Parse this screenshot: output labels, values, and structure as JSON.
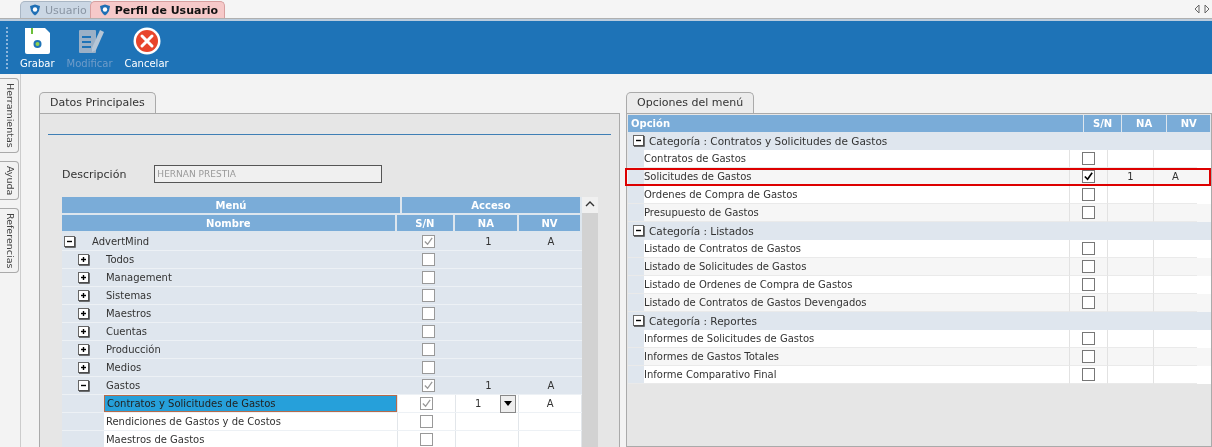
{
  "tabs": [
    {
      "label": "Usuario",
      "selected": false
    },
    {
      "label": "Perfil de Usuario",
      "selected": true
    }
  ],
  "toolbar": [
    {
      "label": "Grabar",
      "kind": "save",
      "disabled": false
    },
    {
      "label": "Modificar",
      "kind": "edit",
      "disabled": true
    },
    {
      "label": "Cancelar",
      "kind": "cancel",
      "disabled": false
    }
  ],
  "side_tabs": [
    "Herramientas",
    "Ayuda",
    "Referencias"
  ],
  "left_panel": {
    "tab": "Datos Principales",
    "description_label": "Descripción",
    "description_value": "HERNAN PRESTIA",
    "grid": {
      "group_headers": [
        "Menú",
        "Acceso"
      ],
      "columns": [
        "Nombre",
        "S/N",
        "NA",
        "NV"
      ],
      "rows": [
        {
          "name": "AdvertMind",
          "checked": true,
          "na": "1",
          "nv": "A",
          "expanded": true,
          "selected": false,
          "children": [
            {
              "name": "Todos",
              "checked": false,
              "expanded": false,
              "selected": false
            },
            {
              "name": "Management",
              "checked": false,
              "expanded": false,
              "selected": false
            },
            {
              "name": "Sistemas",
              "checked": false,
              "expanded": false,
              "selected": false
            },
            {
              "name": "Maestros",
              "checked": false,
              "expanded": false,
              "selected": false
            },
            {
              "name": "Cuentas",
              "checked": false,
              "expanded": false,
              "selected": false
            },
            {
              "name": "Producción",
              "checked": false,
              "expanded": false,
              "selected": false
            },
            {
              "name": "Medios",
              "checked": false,
              "expanded": false,
              "selected": false
            },
            {
              "name": "Gastos",
              "checked": true,
              "na": "1",
              "nv": "A",
              "expanded": true,
              "selected": false,
              "children": [
                {
                  "name": "Contratos y Solicitudes de Gastos",
                  "checked": true,
                  "na": "1",
                  "nv": "A",
                  "selected": true
                },
                {
                  "name": "Rendiciones de Gastos y de Costos",
                  "checked": false,
                  "selected": false
                },
                {
                  "name": "Maestros de Gastos",
                  "checked": false,
                  "selected": false
                }
              ]
            }
          ]
        }
      ]
    }
  },
  "right_panel": {
    "tab": "Opciones del menú",
    "columns": [
      "Opción",
      "S/N",
      "NA",
      "NV"
    ],
    "categories": [
      {
        "label": "Categoría : Contratos y Solicitudes de Gastos",
        "expanded": true,
        "items": [
          {
            "label": "Contratos de Gastos",
            "checked": false,
            "highlighted": false
          },
          {
            "label": "Solicitudes de Gastos",
            "checked": true,
            "na": "1",
            "nv": "A",
            "highlighted": true
          },
          {
            "label": "Ordenes de Compra de Gastos",
            "checked": false,
            "highlighted": false
          },
          {
            "label": "Presupuesto de Gastos",
            "checked": false,
            "highlighted": false
          }
        ]
      },
      {
        "label": "Categoría : Listados",
        "expanded": true,
        "items": [
          {
            "label": "Listado de Contratos de Gastos",
            "checked": false,
            "highlighted": false
          },
          {
            "label": "Listado de Solicitudes de Gastos",
            "checked": false,
            "highlighted": false
          },
          {
            "label": "Listado de Ordenes de Compra de Gastos",
            "checked": false,
            "highlighted": false
          },
          {
            "label": "Listado de Contratos de Gastos Devengados",
            "checked": false,
            "highlighted": false
          }
        ]
      },
      {
        "label": "Categoría : Reportes",
        "expanded": true,
        "items": [
          {
            "label": "Informes de Solicitudes de Gastos",
            "checked": false,
            "highlighted": false
          },
          {
            "label": "Informes de Gastos Totales",
            "checked": false,
            "highlighted": false
          },
          {
            "label": "Informe Comparativo Final",
            "checked": false,
            "highlighted": false
          }
        ]
      }
    ]
  }
}
